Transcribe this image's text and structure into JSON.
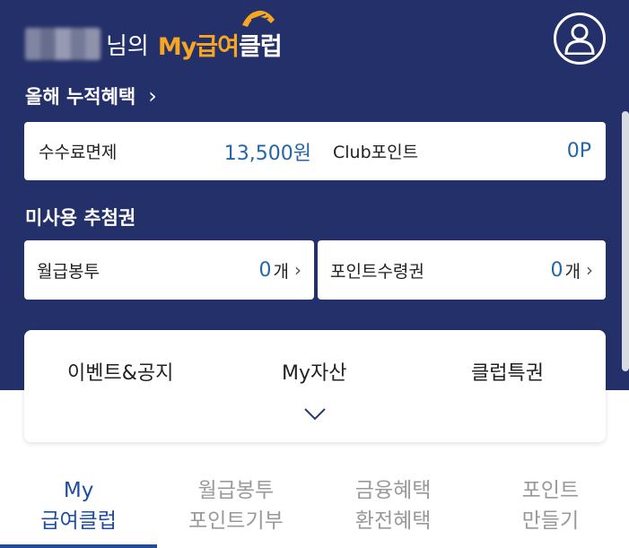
{
  "header": {
    "greeting_suffix": "님의",
    "brand_prefix": "My급여",
    "brand_suffix": "클럽",
    "profile_icon": "person-icon"
  },
  "accumulated": {
    "title": "올해 누적혜택",
    "chevron": "›",
    "fee_label": "수수료면제",
    "fee_value": "13,500원",
    "club_label": "Club포인트",
    "club_value": "0P"
  },
  "unused": {
    "title": "미사용 추첨권",
    "items": [
      {
        "label": "월급봉투",
        "count": "0",
        "unit": "개",
        "chevron": "›"
      },
      {
        "label": "포인트수령권",
        "count": "0",
        "unit": "개",
        "chevron": "›"
      }
    ]
  },
  "menu": {
    "items": [
      {
        "label": "이벤트&공지"
      },
      {
        "label": "My자산"
      },
      {
        "label": "클럽특권"
      }
    ],
    "expand_icon": "chevron-down-icon"
  },
  "tabs": [
    {
      "line1": "My",
      "line2": "급여클럽",
      "active": true
    },
    {
      "line1": "월급봉투",
      "line2": "포인트기부",
      "active": false
    },
    {
      "line1": "금융혜택",
      "line2": "환전혜택",
      "active": false
    },
    {
      "line1": "포인트",
      "line2": "만들기",
      "active": false
    }
  ],
  "colors": {
    "hero_background": "#24306a",
    "brand_accent": "#f6a623",
    "value_blue": "#2466a8",
    "tab_active": "#1f4ea1",
    "tab_inactive": "#999999"
  }
}
